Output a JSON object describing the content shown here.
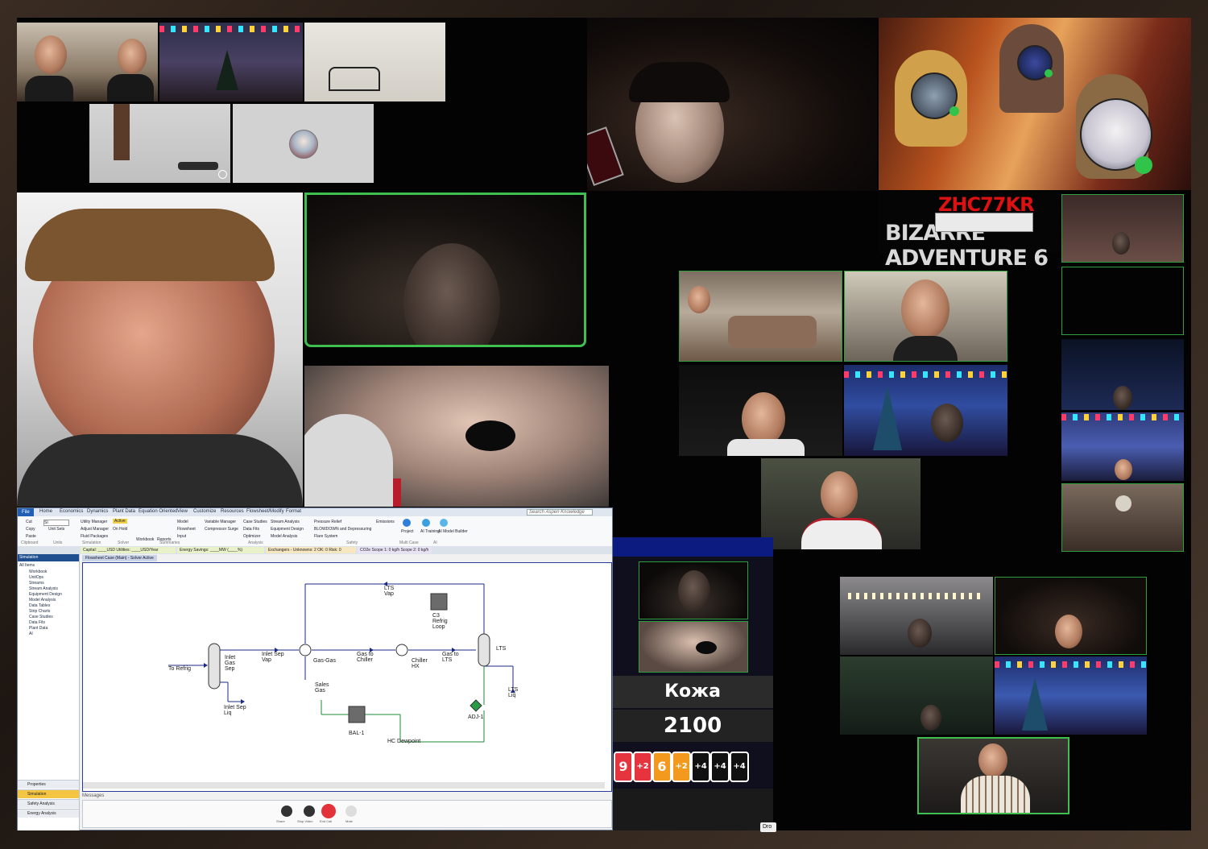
{
  "collage": {
    "jjba_title_line1": "ZHC77KR",
    "jjba_title_line2": "BIZARRE ADVENTURE 6"
  },
  "game": {
    "player_name": "Кожа",
    "score": "2100",
    "cards": [
      "9",
      "+2",
      "6",
      "+2",
      "+4",
      "+4",
      "+4"
    ],
    "drop_label": "Dro"
  },
  "aspen": {
    "menu": [
      "File",
      "Home",
      "Economics",
      "Dynamics",
      "Plant Data",
      "Equation Oriented",
      "View",
      "Customize",
      "Resources",
      "Flowsheet/Modify",
      "Format"
    ],
    "search_placeholder": "Search Aspen Knowledge",
    "clipboard": [
      "Cut",
      "Copy",
      "Paste"
    ],
    "units": [
      "SI",
      "Unit Sets"
    ],
    "simulation_tools": [
      "Utility Manager",
      "Adjust Manager",
      "Fluid Packages"
    ],
    "active_label": "Active",
    "on_hold_label": "On Hold",
    "ribbon_big": [
      "Workbook",
      "Reports"
    ],
    "ribbon_small": [
      "Model",
      "Flowsheet",
      "Input",
      "Variable Manager",
      "Compressor Surge",
      "Case Studies",
      "Data Fits",
      "Optimizer",
      "Model Analysis",
      "Stream Analysis",
      "Equipment Design",
      "Pressure Relief",
      "BLOWDOWN and Depressuring",
      "Flare System",
      "Emissions"
    ],
    "ribbon_icons": [
      "Project",
      "AI Training",
      "AI Model Builder"
    ],
    "group_labels": [
      "Clipboard",
      "Units",
      "Simulation",
      "Solver",
      "Summaries",
      "Analysis",
      "Safety",
      "Multi Case",
      "AI"
    ],
    "kpis": [
      "Capital: ____USD  Utilities: ____USD/Year",
      "Energy Savings: ____MW  (____%)",
      "Exchangers - Unknowns: 2  OK: 0  Risk: 0",
      "CO2e Scope 1: 0 kg/h  Scope 2: 0 kg/h"
    ],
    "nav_header": "Simulation",
    "nav_filter": "All Items",
    "nav_items": [
      "Workbook",
      "UnitOps",
      "Streams",
      "Stream Analysis",
      "Equipment Design",
      "Model Analysis",
      "Data Tables",
      "Strip Charts",
      "Case Studies",
      "Data Fits",
      "Plant Data",
      "AI"
    ],
    "nav_bottom": [
      "Properties",
      "Simulation",
      "Safety Analysis",
      "Energy Analysis"
    ],
    "flowsheet_tab": "Flowsheet Case (Main) - Solver Active",
    "messages_label": "Messages",
    "pfd_labels": {
      "to_refrig": "To Refrig",
      "inlet_gas_sep": "Inlet\nGas\nSep",
      "inlet_sep_vap": "Inlet Sep\nVap",
      "inlet_sep_liq": "Inlet Sep\nLiq",
      "gas_gas": "Gas-Gas",
      "sales_gas": "Sales\nGas",
      "gas_to_chiller": "Gas to\nChiller",
      "chiller_hx": "Chiller\nHX",
      "gas_to_lts": "Gas to\nLTS",
      "lts": "LTS",
      "lts_vap": "LTS\nVap",
      "lts_liq": "LTS\nLiq",
      "c3_refrig_loop": "C3\nRefrig\nLoop",
      "adj_1": "ADJ-1",
      "bal_1": "BAL-1",
      "hc_dewpoint": "HC Dewpoint"
    },
    "call_controls": [
      "Share",
      "Stop Video",
      "End Call",
      "Mute"
    ]
  },
  "colors": {
    "speaking_border": "#3fbf4f",
    "aspen_accent": "#1f5fb4",
    "uno_red": "#e6343f",
    "uno_orange": "#f39a1e"
  }
}
